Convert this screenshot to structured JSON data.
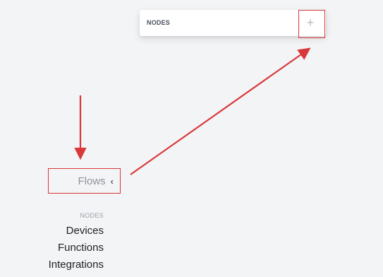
{
  "nodes_panel": {
    "title": "NODES",
    "add_label": "+"
  },
  "sidebar": {
    "flows_label": "Flows",
    "flows_chevron": "‹",
    "section_label": "NODES",
    "items": [
      {
        "label": "Devices"
      },
      {
        "label": "Functions"
      },
      {
        "label": "Integrations"
      }
    ]
  },
  "annotation": {
    "color": "#d9383a"
  }
}
